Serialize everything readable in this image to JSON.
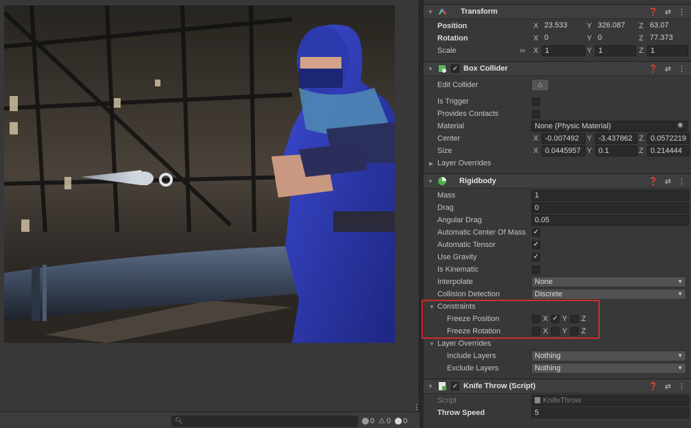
{
  "console": {
    "counts": [
      "0",
      "0",
      "0"
    ]
  },
  "transform": {
    "title": "Transform",
    "position": {
      "label": "Position",
      "x": "23.533",
      "y": "326.087",
      "z": "63.07"
    },
    "rotation": {
      "label": "Rotation",
      "x": "0",
      "y": "0",
      "z": "77.373"
    },
    "scale": {
      "label": "Scale",
      "x": "1",
      "y": "1",
      "z": "1"
    }
  },
  "axis": {
    "x": "X",
    "y": "Y",
    "z": "Z"
  },
  "box_collider": {
    "title": "Box Collider",
    "edit_collider": "Edit Collider",
    "is_trigger": "Is Trigger",
    "provides_contacts": "Provides Contacts",
    "material": {
      "label": "Material",
      "value": "None (Physic Material)"
    },
    "center": {
      "label": "Center",
      "x": "-0.007492",
      "y": "-3.437862",
      "z": "0.0572219"
    },
    "size": {
      "label": "Size",
      "x": "0.0445957",
      "y": "0.1",
      "z": "0.214444"
    },
    "layer_overrides": "Layer Overrides"
  },
  "rigidbody": {
    "title": "Rigidbody",
    "mass": {
      "label": "Mass",
      "value": "1"
    },
    "drag": {
      "label": "Drag",
      "value": "0"
    },
    "angular_drag": {
      "label": "Angular Drag",
      "value": "0.05"
    },
    "auto_com": "Automatic Center Of Mass",
    "auto_tensor": "Automatic Tensor",
    "use_gravity": "Use Gravity",
    "is_kinematic": "Is Kinematic",
    "interpolate": {
      "label": "Interpolate",
      "value": "None"
    },
    "collision_detection": {
      "label": "Collision Detection",
      "value": "Discrete"
    },
    "constraints": "Constraints",
    "freeze_position": "Freeze Position",
    "freeze_rotation": "Freeze Rotation",
    "layer_overrides": "Layer Overrides",
    "include_layers": {
      "label": "Include Layers",
      "value": "Nothing"
    },
    "exclude_layers": {
      "label": "Exclude Layers",
      "value": "Nothing"
    }
  },
  "knife_throw": {
    "title": "Knife Throw (Script)",
    "script": {
      "label": "Script",
      "value": "KnifeThrow"
    },
    "throw_speed": {
      "label": "Throw Speed",
      "value": "5"
    }
  },
  "colors": {
    "highlight": "#d12c2c",
    "ninja_blue": "#2a36b0"
  }
}
